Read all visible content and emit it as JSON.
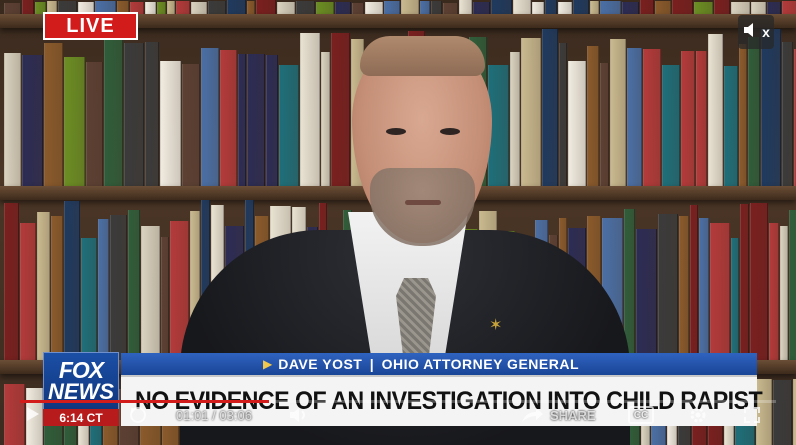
{
  "live_badge": {
    "label": "LIVE"
  },
  "mute": {
    "icon": "speaker-muted-icon",
    "label": "x"
  },
  "network": {
    "logo_line1": "FOX",
    "logo_line2": "NEWS",
    "time": "6:14 CT"
  },
  "lower_third": {
    "name": "DAVE YOST",
    "separator": "|",
    "title": "OHIO ATTORNEY GENERAL",
    "headline": "NO EVIDENCE OF AN INVESTIGATION INTO CHILD RAPIST"
  },
  "player": {
    "current_time": "01:01",
    "separator": "/",
    "duration": "03:06",
    "progress": 0.33,
    "share_label": "SHARE",
    "cc_label": "CC",
    "icons": [
      "play-icon",
      "replay-icon",
      "volume-icon",
      "share-icon",
      "settings-icon",
      "fullscreen-icon"
    ]
  },
  "colors": {
    "live_red": "#d21c1c",
    "fox_blue": "#1b4fa6",
    "name_bar_blue": "#2f63c0",
    "headline_bg": "#f4f4f4"
  }
}
